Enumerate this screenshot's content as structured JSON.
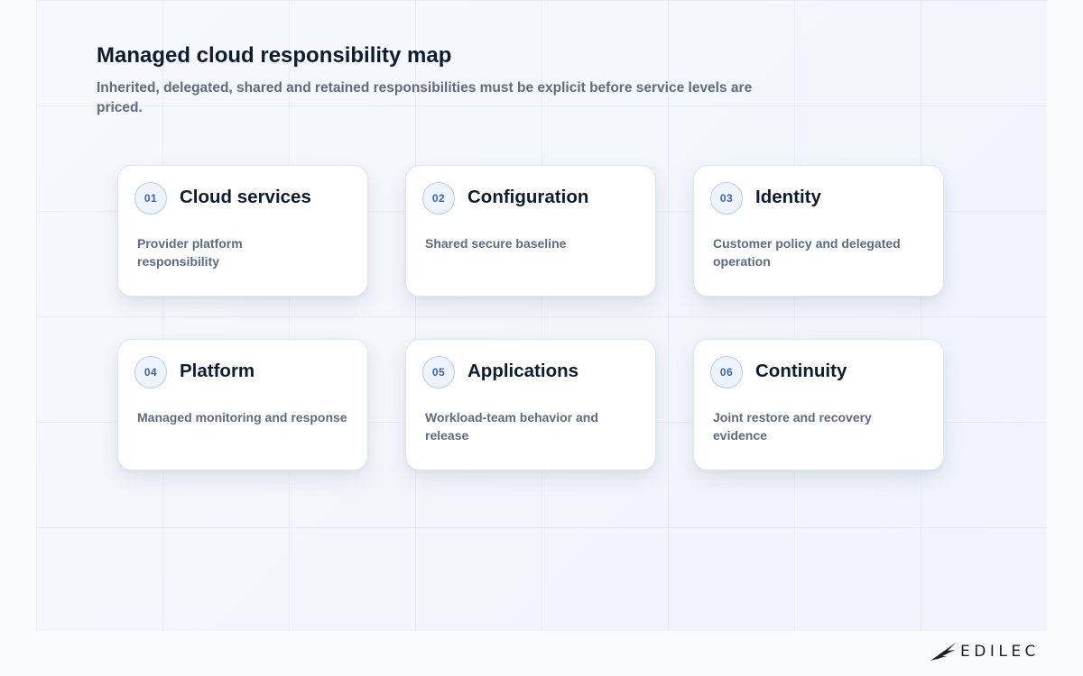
{
  "header": {
    "title": "Managed cloud responsibility map",
    "subtitle": "Inherited, delegated, shared and retained responsibilities must be explicit before service levels are priced."
  },
  "cards": [
    {
      "number": "01",
      "title": "Cloud services",
      "description": "Provider platform responsibility"
    },
    {
      "number": "02",
      "title": "Configuration",
      "description": "Shared secure baseline"
    },
    {
      "number": "03",
      "title": "Identity",
      "description": "Customer policy and delegated operation"
    },
    {
      "number": "04",
      "title": "Platform",
      "description": "Managed monitoring and response"
    },
    {
      "number": "05",
      "title": "Applications",
      "description": "Workload-team behavior and release"
    },
    {
      "number": "06",
      "title": "Continuity",
      "description": "Joint restore and recovery evidence"
    }
  ],
  "brand": {
    "name": "EDILEC",
    "logo_icon": "bird-wing-icon"
  },
  "colors": {
    "title": "#0f1b2e",
    "muted_text": "#5f6b7e",
    "badge_text": "#3a62a8",
    "badge_border": "#b8cdef",
    "card_border": "#dfe5ef"
  }
}
